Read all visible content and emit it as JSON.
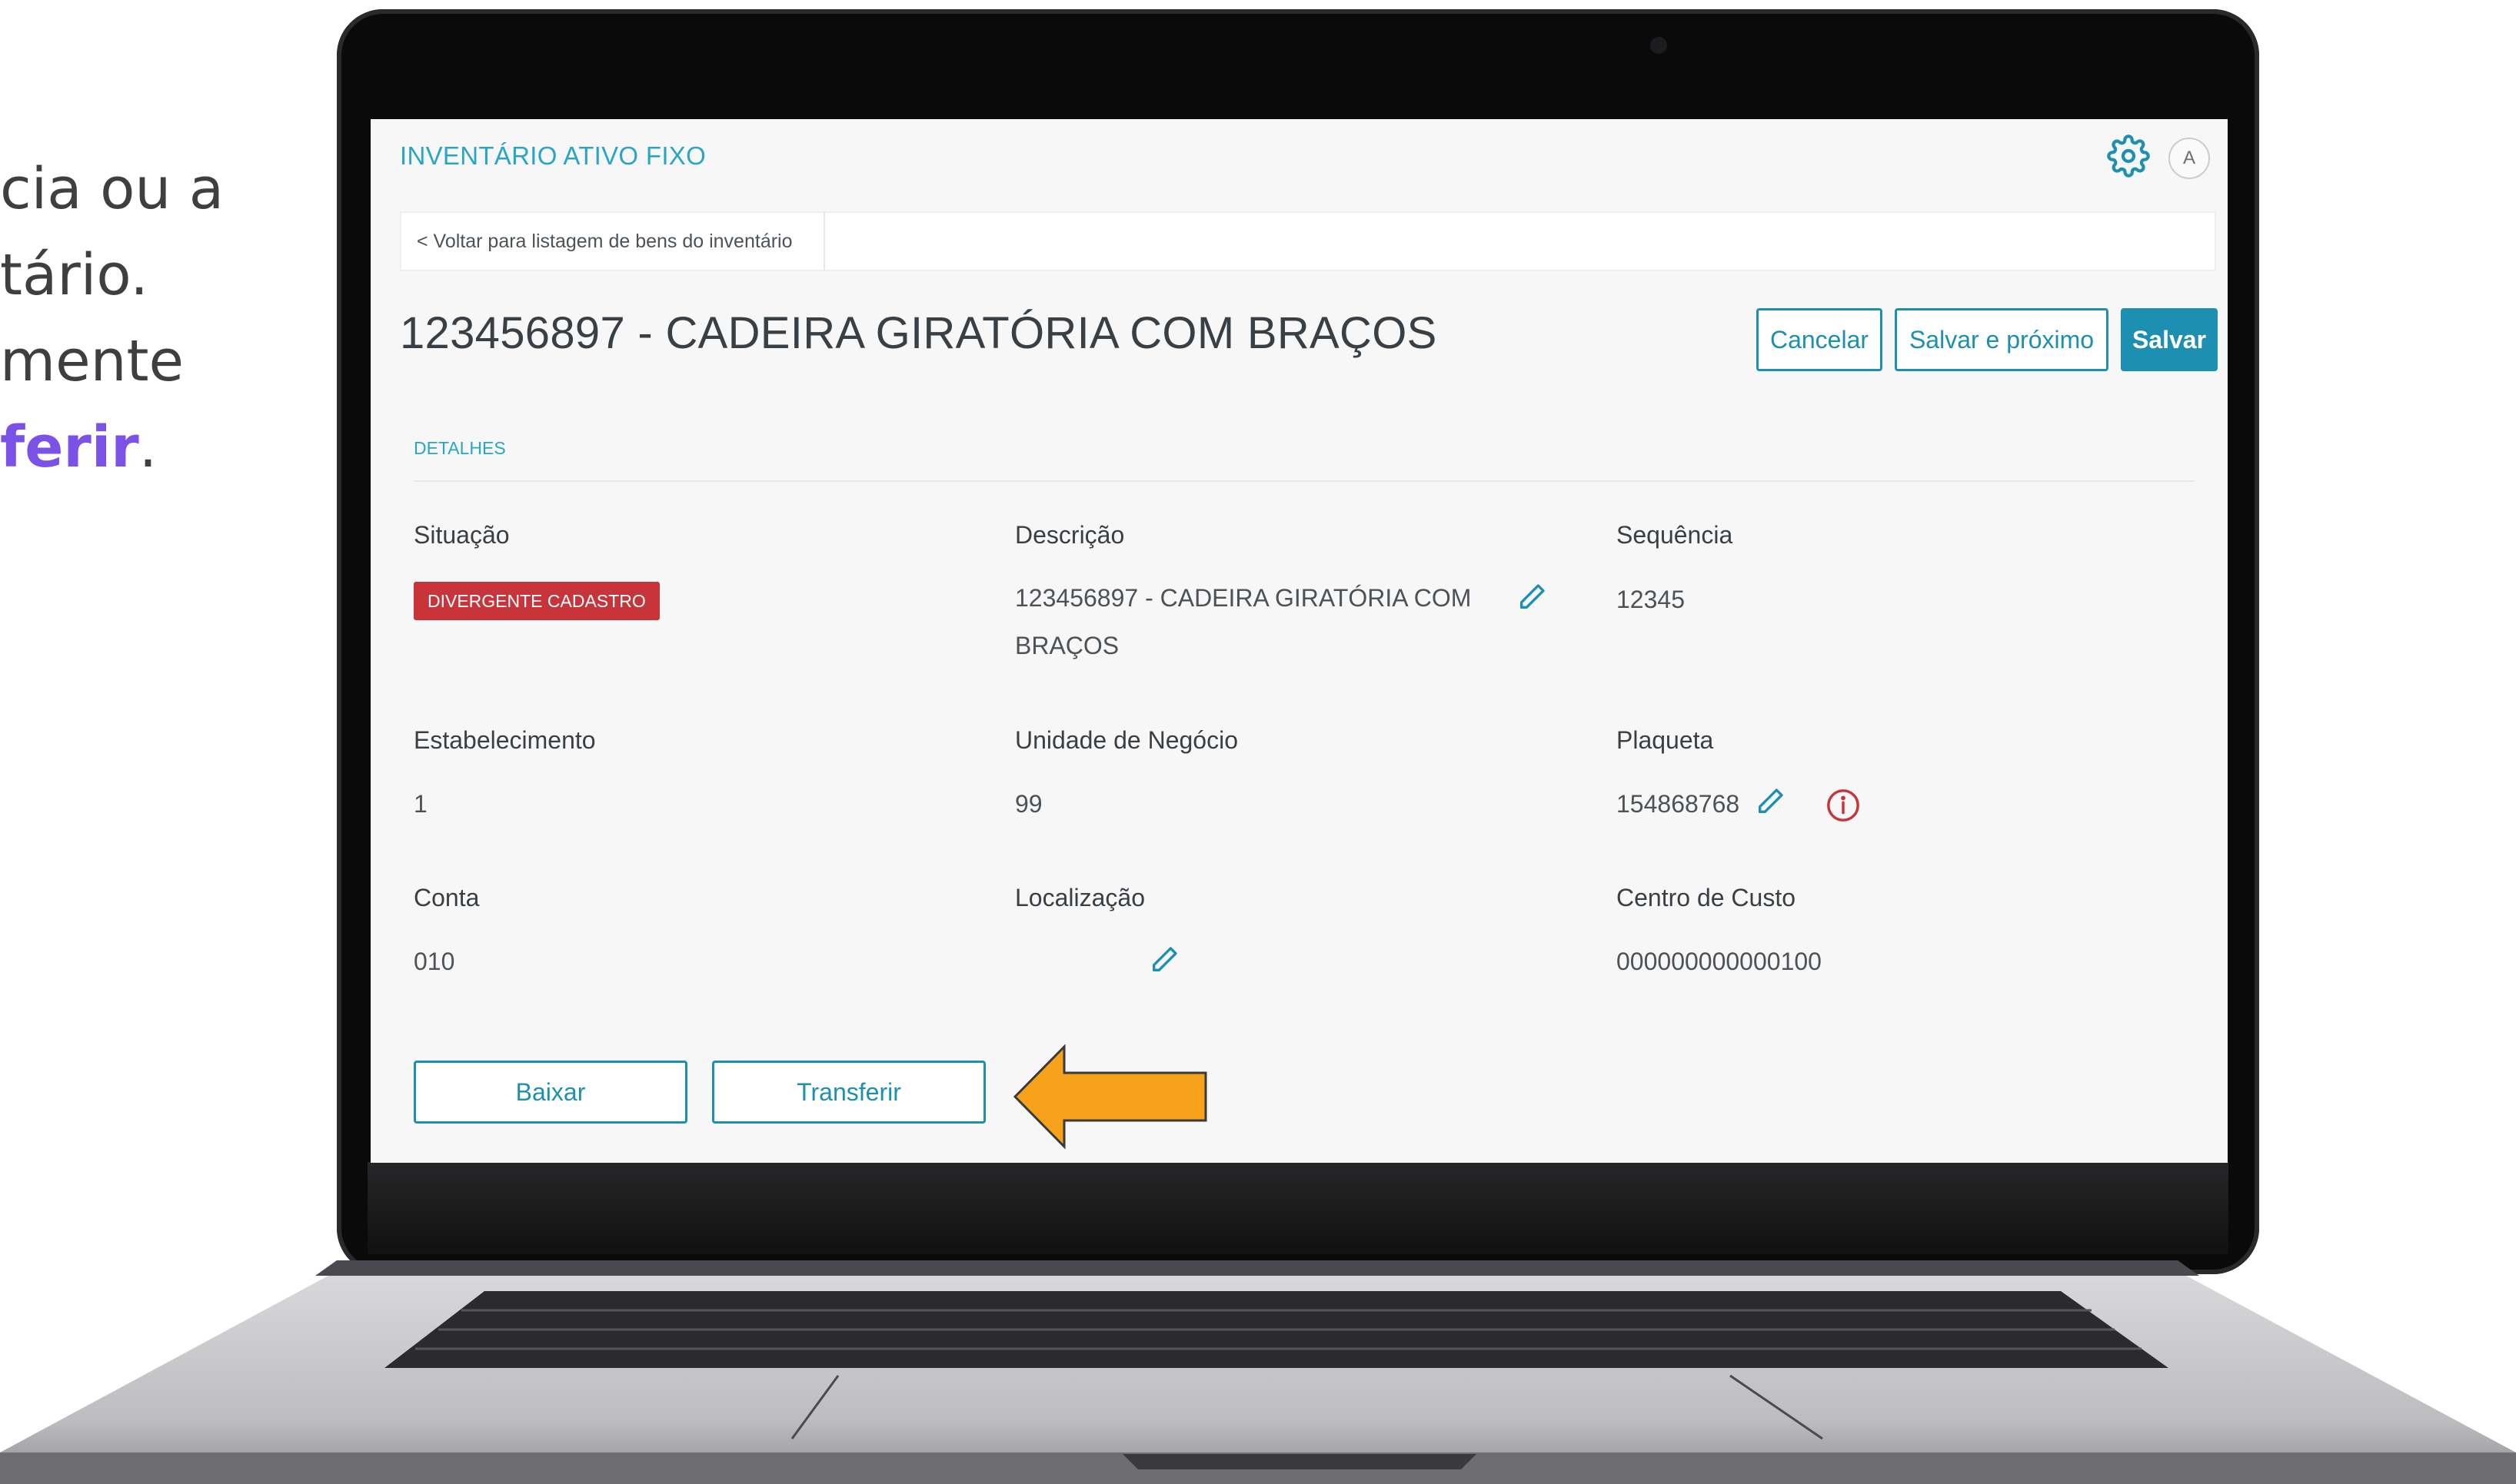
{
  "side_text": {
    "line1": "cia ou a",
    "line2": "tário.",
    "line3": "mente",
    "line4_highlight": "ferir",
    "line4_tail": "."
  },
  "app": {
    "title": "INVENTÁRIO ATIVO FIXO",
    "avatar_initial": "A"
  },
  "breadcrumb": {
    "label": "< Voltar para listagem de bens do inventário"
  },
  "page": {
    "title": "123456897 - CADEIRA GIRATÓRIA COM BRAÇOS"
  },
  "actions": {
    "cancel": "Cancelar",
    "save_next": "Salvar e próximo",
    "save": "Salvar"
  },
  "details": {
    "section_label": "DETALHES",
    "situacao": {
      "label": "Situação",
      "value": "DIVERGENTE CADASTRO"
    },
    "descricao": {
      "label": "Descrição",
      "value": "123456897 - CADEIRA GIRATÓRIA COM BRAÇOS"
    },
    "sequencia": {
      "label": "Sequência",
      "value": "12345"
    },
    "estabelecimento": {
      "label": "Estabelecimento",
      "value": "1"
    },
    "unidade_negocio": {
      "label": "Unidade de Negócio",
      "value": "99"
    },
    "plaqueta": {
      "label": "Plaqueta",
      "value": "154868768"
    },
    "conta": {
      "label": "Conta",
      "value": "010"
    },
    "localizacao": {
      "label": "Localização",
      "value": ""
    },
    "centro_custo": {
      "label": "Centro de Custo",
      "value": "000000000000100"
    }
  },
  "bottom_actions": {
    "baixar": "Baixar",
    "transferir": "Transferir"
  },
  "colors": {
    "accent": "#1d8fb0",
    "title_accent": "#2aa6c4",
    "badge_red": "#c7353b",
    "arrow_orange": "#f7a21b",
    "highlight_purple": "#7b52e8"
  }
}
